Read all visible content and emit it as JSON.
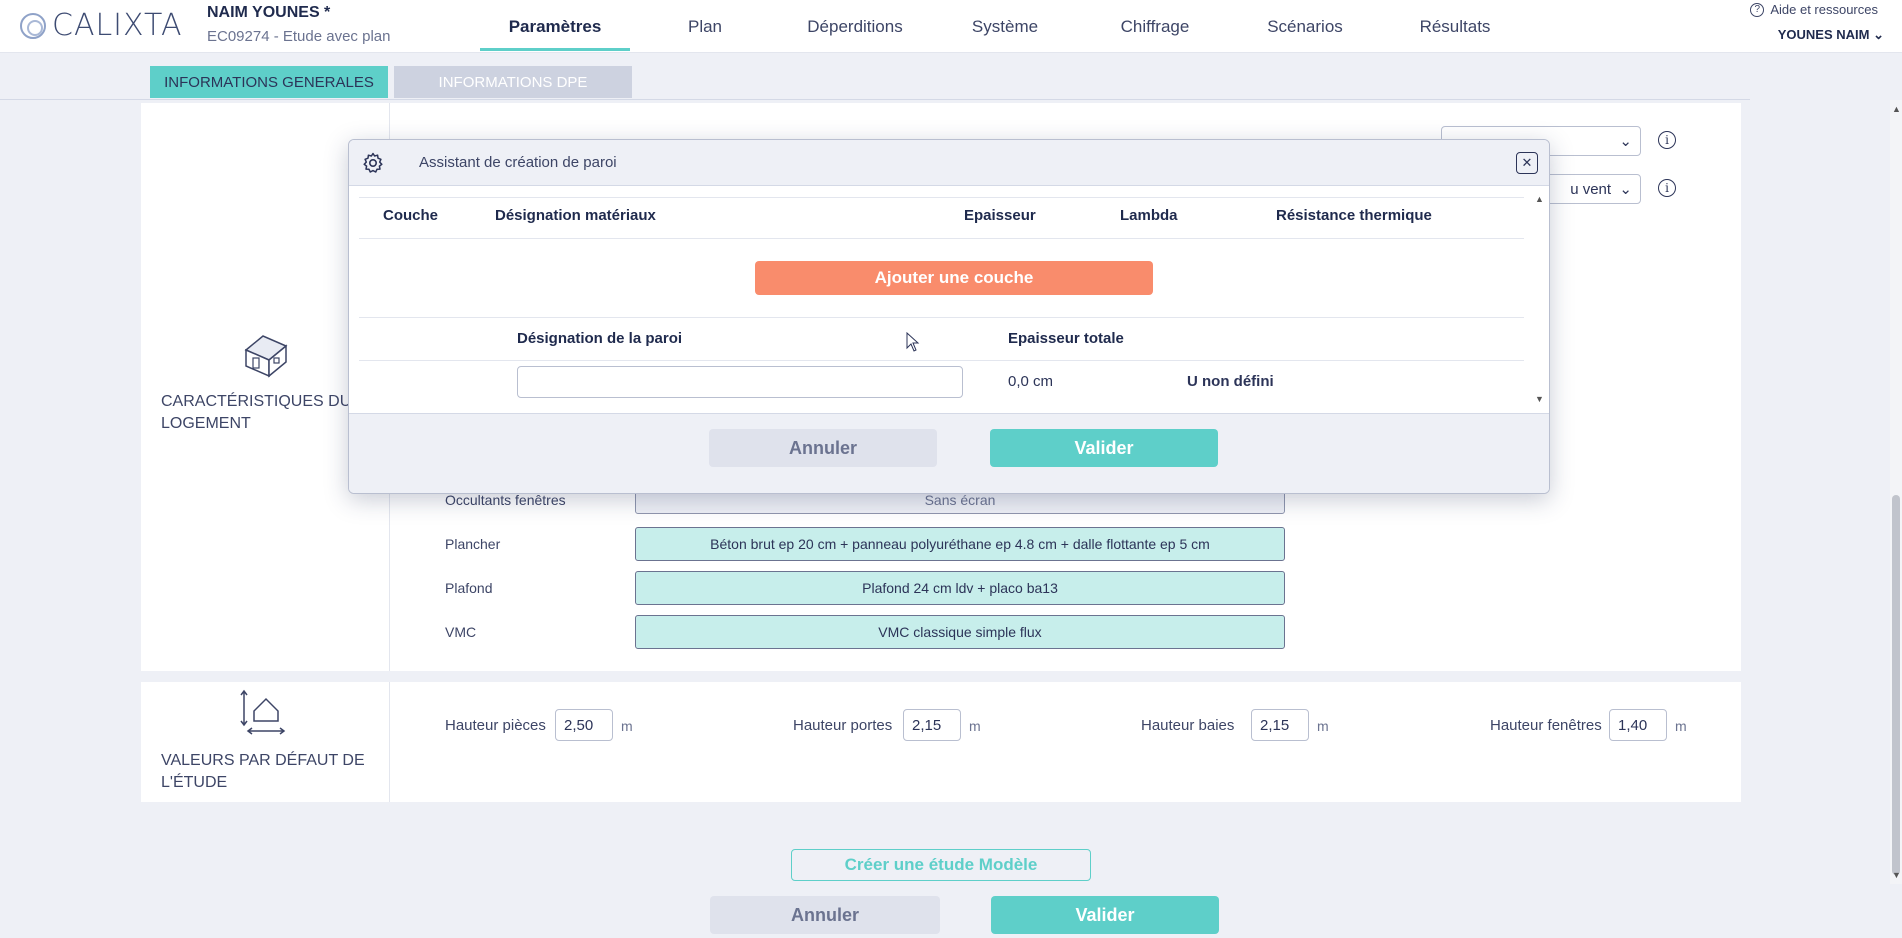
{
  "header": {
    "logo_text": "CALIXTA",
    "client_name": "NAIM YOUNES *",
    "study_name": "EC09274 - Etude avec plan",
    "nav": [
      "Paramètres",
      "Plan",
      "Déperditions",
      "Système",
      "Chiffrage",
      "Scénarios",
      "Résultats"
    ],
    "active_nav": "Paramètres",
    "help_label": "Aide et ressources",
    "user_label": "YOUNES NAIM"
  },
  "tabs": {
    "general": "INFORMATIONS GENERALES",
    "dpe": "INFORMATIONS DPE"
  },
  "logement": {
    "title": "CARACTÉRISTIQUES DU LOGEMENT",
    "background_select_2": "u vent",
    "rows": [
      {
        "label": "Occultants fenêtres",
        "value": "Sans écran"
      },
      {
        "label": "Plancher",
        "value": "Béton brut ep 20 cm + panneau polyuréthane ep 4.8 cm + dalle flottante ep 5 cm"
      },
      {
        "label": "Plafond",
        "value": "Plafond 24 cm ldv + placo ba13"
      },
      {
        "label": "VMC",
        "value": "VMC classique simple flux"
      }
    ]
  },
  "defaults": {
    "title": "VALEURS PAR DÉFAUT DE L'ÉTUDE",
    "fields": [
      {
        "label": "Hauteur pièces",
        "value": "2,50",
        "unit": "m"
      },
      {
        "label": "Hauteur portes",
        "value": "2,15",
        "unit": "m"
      },
      {
        "label": "Hauteur baies",
        "value": "2,15",
        "unit": "m"
      },
      {
        "label": "Hauteur fenêtres",
        "value": "1,40",
        "unit": "m"
      }
    ]
  },
  "creer_modele": "Créer une étude Modèle",
  "footer": {
    "cancel": "Annuler",
    "validate": "Valider"
  },
  "modal": {
    "title": "Assistant de création de paroi",
    "columns": [
      "Couche",
      "Désignation matériaux",
      "Epaisseur",
      "Lambda",
      "Résistance thermique"
    ],
    "add_layer": "Ajouter une couche",
    "designation_header": "Désignation de la paroi",
    "thickness_header": "Epaisseur totale",
    "designation_value": "",
    "thickness_value": "0,0 cm",
    "u_value": "U non défini",
    "cancel": "Annuler",
    "validate": "Valider"
  },
  "colors": {
    "accent": "#5ecfc9",
    "add_button": "#f98c6c",
    "text": "#2c3458"
  }
}
